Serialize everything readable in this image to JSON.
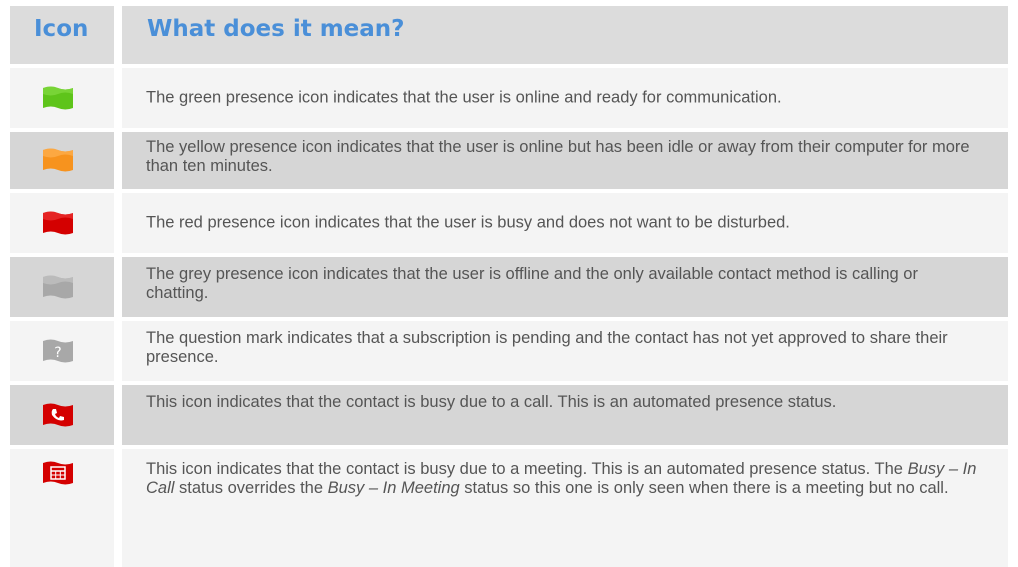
{
  "header": {
    "icon_col": "Icon",
    "meaning_col": "What does it mean?"
  },
  "rows": [
    {
      "icon": "green-flag-icon",
      "color": "#5ec41a",
      "text": "The green presence icon indicates that the user is online and ready for communication."
    },
    {
      "icon": "yellow-flag-icon",
      "color": "#f7931e",
      "text": "The yellow presence icon indicates that the user is online but has been idle or away from their computer for more than ten minutes."
    },
    {
      "icon": "red-flag-icon",
      "color": "#d40000",
      "text": "The red presence icon indicates that the user is busy and does not want to be disturbed."
    },
    {
      "icon": "grey-flag-icon",
      "color": "#a8a8a8",
      "text": "The grey presence icon indicates that the user is offline and the only available contact method is calling or chatting."
    },
    {
      "icon": "question-mark-icon",
      "color": "#a8a8a8",
      "text": "The question mark indicates that a subscription is pending and the contact has not yet approved to share their presence."
    },
    {
      "icon": "phone-flag-icon",
      "color": "#d40000",
      "text": "This icon indicates that the contact is busy due to a call.  This is an automated presence status."
    },
    {
      "icon": "calendar-flag-icon",
      "color": "#d40000",
      "text_parts": {
        "a": "This icon indicates that the contact is busy due to a meeting.  This is an automated presence status.  The ",
        "b": "Busy – In Call",
        "c": " status overrides the ",
        "d": "Busy – In Meeting",
        "e": " status so this one is only seen when there is a meeting but no call."
      }
    }
  ]
}
